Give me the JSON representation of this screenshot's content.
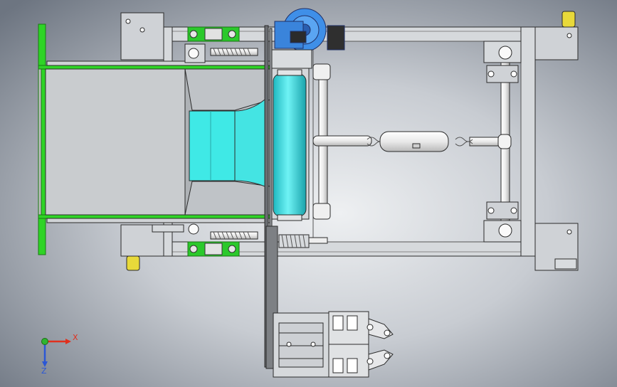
{
  "viewport": {
    "background_colors": [
      "#6f7783",
      "#c9cdd3",
      "#e6e8eb",
      "#8f98a5"
    ]
  },
  "triad": {
    "x_label": "X",
    "z_label": "Z",
    "x_color": "#e0301e",
    "y_color": "#2fb52f",
    "z_color": "#2b57d6"
  },
  "colors": {
    "frame": "#d3d6da",
    "edge": "#2b2b2b",
    "green_frame": "#27d61f",
    "roller": "#36e0e6",
    "hopper_liquid": "#3fe9e6",
    "motor": "#3f8fe8",
    "bearing_green": "#2bc92b",
    "foot_yellow": "#e8d93a",
    "shaft": "#f2f2f2"
  }
}
